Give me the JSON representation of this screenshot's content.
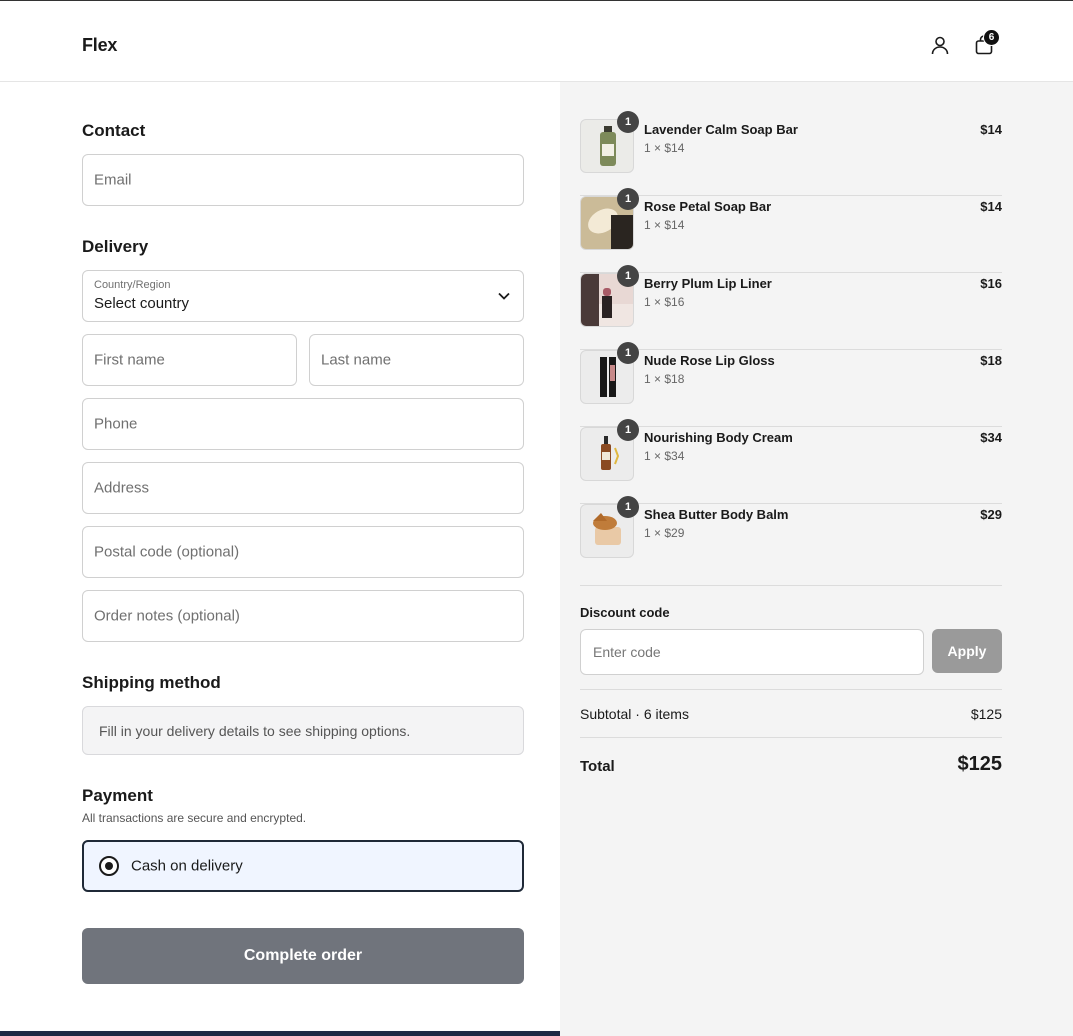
{
  "header": {
    "logo": "Flex",
    "bag_count": "6"
  },
  "contact": {
    "title": "Contact",
    "email_placeholder": "Email"
  },
  "delivery": {
    "title": "Delivery",
    "country_label": "Country/Region",
    "country_value": "Select country",
    "first_name_placeholder": "First name",
    "last_name_placeholder": "Last name",
    "phone_placeholder": "Phone",
    "address_placeholder": "Address",
    "postal_placeholder": "Postal code (optional)",
    "notes_placeholder": "Order notes (optional)"
  },
  "shipping": {
    "title": "Shipping method",
    "message": "Fill in your delivery details to see shipping options."
  },
  "payment": {
    "title": "Payment",
    "subtitle": "All transactions are secure and encrypted.",
    "option_label": "Cash on delivery"
  },
  "complete_button": "Complete order",
  "cart": {
    "items": [
      {
        "name": "Lavender Calm Soap Bar",
        "qty": "1",
        "sub": "1 × $14",
        "price": "$14",
        "icon": "soap-bottle"
      },
      {
        "name": "Rose Petal Soap Bar",
        "qty": "1",
        "sub": "1 × $14",
        "price": "$14",
        "icon": "soap-bar"
      },
      {
        "name": "Berry Plum Lip Liner",
        "qty": "1",
        "sub": "1 × $16",
        "price": "$16",
        "icon": "lipstick"
      },
      {
        "name": "Nude Rose Lip Gloss",
        "qty": "1",
        "sub": "1 × $18",
        "price": "$18",
        "icon": "lip-gloss"
      },
      {
        "name": "Nourishing Body Cream",
        "qty": "1",
        "sub": "1 × $34",
        "price": "$34",
        "icon": "dropper-bottle"
      },
      {
        "name": "Shea Butter Body Balm",
        "qty": "1",
        "sub": "1 × $29",
        "price": "$29",
        "icon": "balm-jar"
      }
    ],
    "discount_label": "Discount code",
    "discount_placeholder": "Enter code",
    "apply_label": "Apply",
    "subtotal_label": "Subtotal · 6 items",
    "subtotal_value": "$125",
    "total_label": "Total",
    "total_value": "$125"
  },
  "colors": {
    "button_disabled": "#70747c",
    "apply_disabled": "#9a9a9a",
    "summary_bg": "#f4f4f4",
    "payment_selected_bg": "#f0f5ff"
  }
}
